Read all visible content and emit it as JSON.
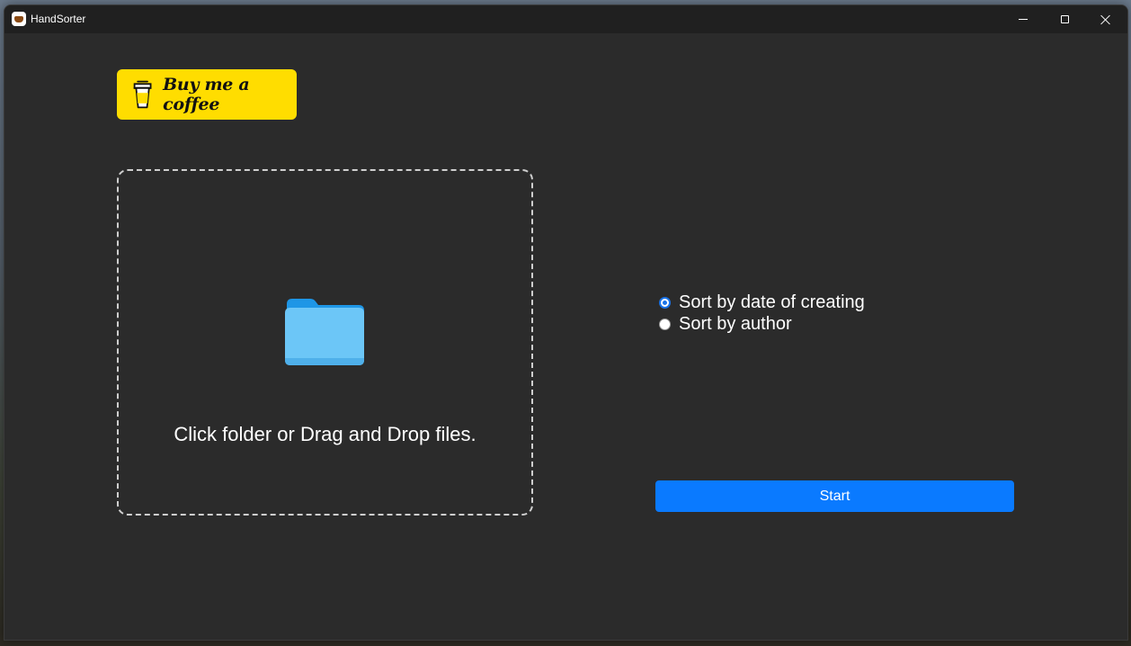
{
  "window": {
    "title": "HandSorter",
    "app_icon": "coffee-cup-icon",
    "controls": {
      "minimize_icon": "minimize-icon",
      "maximize_icon": "maximize-icon",
      "close_icon": "close-icon"
    }
  },
  "coffee_button": {
    "label": "Buy me a coffee",
    "icon": "coffee-cup-icon",
    "color": "#ffdd00"
  },
  "dropzone": {
    "icon": "folder-icon",
    "text": "Click folder or Drag and Drop files."
  },
  "sort_options": [
    {
      "label": "Sort by date of creating",
      "checked": true
    },
    {
      "label": "Sort by author",
      "checked": false
    }
  ],
  "start_button": {
    "label": "Start",
    "color": "#0a7aff"
  },
  "colors": {
    "background": "#2b2b2b",
    "titlebar": "#202020",
    "accent": "#0a7aff"
  }
}
